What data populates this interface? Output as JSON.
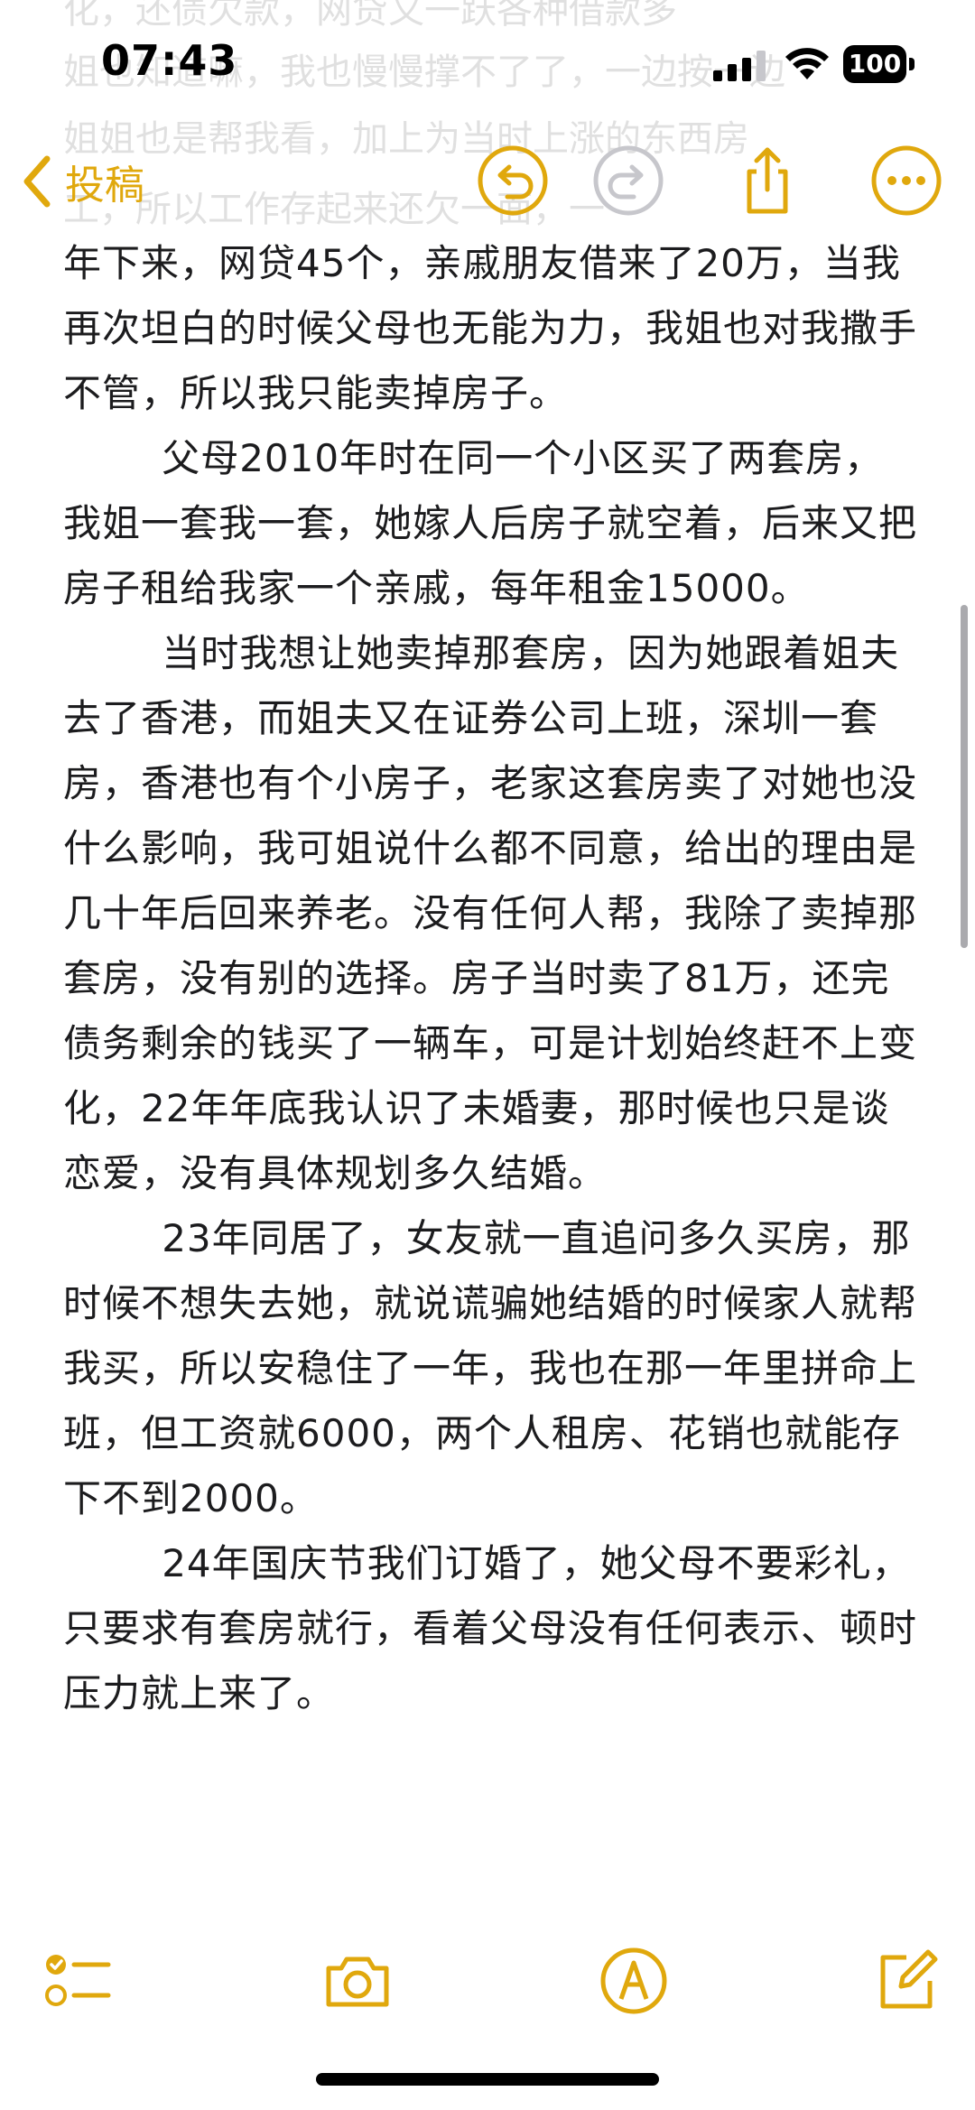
{
  "status_bar": {
    "time": "07:43",
    "battery": "100",
    "icons": [
      "cellular-signal-icon",
      "wifi-icon",
      "battery-icon"
    ]
  },
  "nav": {
    "back_label": "投稿",
    "icons": [
      "chevron-left-icon",
      "undo-icon",
      "redo-icon",
      "share-icon",
      "more-icon"
    ]
  },
  "colors": {
    "accent": "#e0a80d",
    "text": "#1c1c1e",
    "disabled": "#c7c7cc"
  },
  "note": {
    "ghost_lines": [
      "化，还债欠款，网贷又一跃各种借款多",
      "姐也知道嘛，我也慢慢撑不了了，一边按一边",
      "姐姐也是帮我看，加上为当时上涨的东西房",
      "工，所以工作存起来还欠一面，一"
    ],
    "paragraphs": [
      "年下来，网贷45个，亲戚朋友借来了20万，当我再次坦白的时候父母也无能为力，我姐也对我撒手不管，所以我只能卖掉房子。",
      "父母2010年时在同一个小区买了两套房，我姐一套我一套，她嫁人后房子就空着，后来又把房子租给我家一个亲戚，每年租金15000。",
      "当时我想让她卖掉那套房，因为她跟着姐夫去了香港，而姐夫又在证券公司上班，深圳一套房，香港也有个小房子，老家这套房卖了对她也没什么影响，我可姐说什么都不同意，给出的理由是几十年后回来养老。没有任何人帮，我除了卖掉那套房，没有别的选择。房子当时卖了81万，还完债务剩余的钱买了一辆车，可是计划始终赶不上变化，22年年底我认识了未婚妻，那时候也只是谈恋爱，没有具体规划多久结婚。",
      "23年同居了，女友就一直追问多久买房，那时候不想失去她，就说谎骗她结婚的时候家人就帮我买，所以安稳住了一年，我也在那一年里拼命上班，但工资就6000，两个人租房、花销也就能存下不到2000。",
      "24年国庆节我们订婚了，她父母不要彩礼，只要求有套房就行，看着父母没有任何表示、顿时压力就上来了。"
    ]
  },
  "bottom_toolbar": {
    "icons": [
      "checklist-icon",
      "camera-icon",
      "markup-icon",
      "compose-icon"
    ]
  }
}
